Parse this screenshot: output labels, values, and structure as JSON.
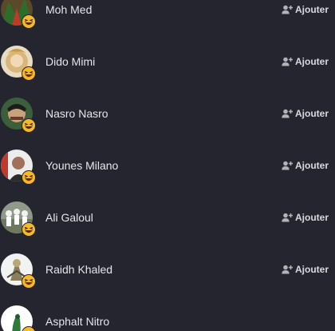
{
  "icons": {
    "add_friend": "add-friend-icon",
    "reaction": "laughing-emoji-icon"
  },
  "colors": {
    "background": "#25252f",
    "name_text": "#e4e6eb",
    "button_text": "#d8dadf",
    "emoji_yellow": "#f7b928"
  },
  "people": [
    {
      "name": "Moh Med",
      "action": "Ajouter"
    },
    {
      "name": "Dido Mimi",
      "action": "Ajouter"
    },
    {
      "name": "Nasro Nasro",
      "action": "Ajouter"
    },
    {
      "name": "Younes Milano",
      "action": "Ajouter"
    },
    {
      "name": "Ali Galoul",
      "action": "Ajouter"
    },
    {
      "name": "Raidh Khaled",
      "action": "Ajouter"
    },
    {
      "name": "Asphalt Nitro",
      "action": ""
    }
  ]
}
